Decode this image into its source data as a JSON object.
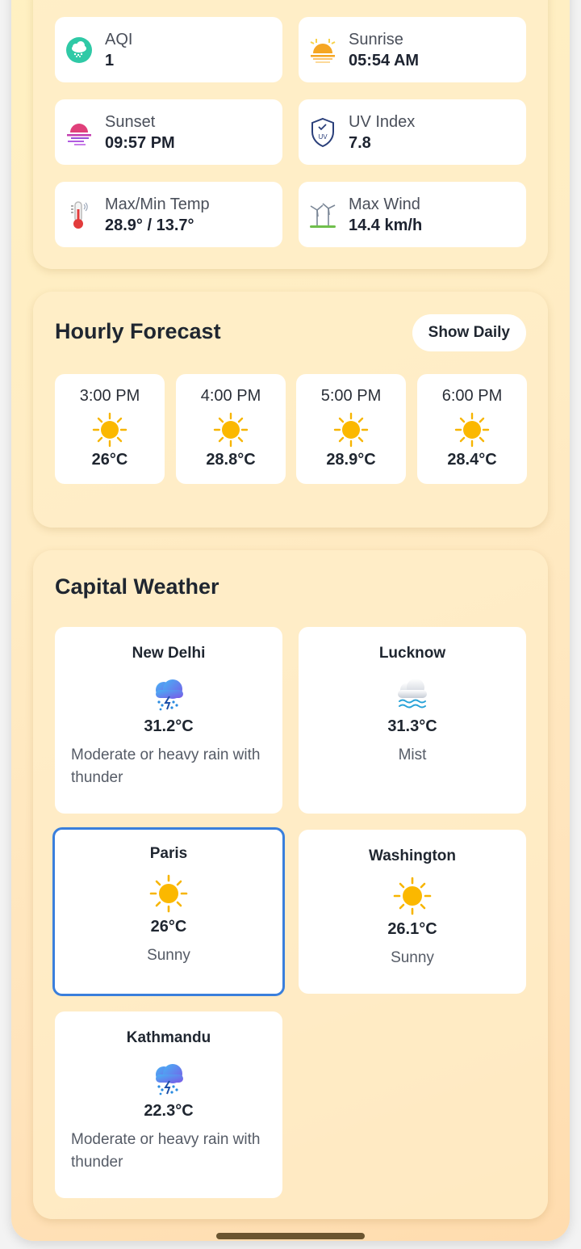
{
  "stats": [
    {
      "label": "AQI",
      "value": "1",
      "icon": "aqi-cloud-icon"
    },
    {
      "label": "Sunrise",
      "value": "05:54 AM",
      "icon": "sunrise-icon"
    },
    {
      "label": "Sunset",
      "value": "09:57 PM",
      "icon": "sunset-icon"
    },
    {
      "label": "UV Index",
      "value": "7.8",
      "icon": "uv-shield-icon"
    },
    {
      "label": "Max/Min Temp",
      "value": "28.9° / 13.7°",
      "icon": "thermometer-icon"
    },
    {
      "label": "Max Wind",
      "value": "14.4 km/h",
      "icon": "wind-turbine-icon"
    }
  ],
  "hourly": {
    "title": "Hourly Forecast",
    "toggle_label": "Show Daily",
    "items": [
      {
        "time": "3:00 PM",
        "temp": "26°C",
        "icon": "sun-icon"
      },
      {
        "time": "4:00 PM",
        "temp": "28.8°C",
        "icon": "sun-icon"
      },
      {
        "time": "5:00 PM",
        "temp": "28.9°C",
        "icon": "sun-icon"
      },
      {
        "time": "6:00 PM",
        "temp": "28.4°C",
        "icon": "sun-icon"
      }
    ]
  },
  "capitals": {
    "title": "Capital Weather",
    "items": [
      {
        "name": "New Delhi",
        "temp": "31.2°C",
        "condition": "Moderate or heavy rain with thunder",
        "icon": "thunder-rain-icon"
      },
      {
        "name": "Lucknow",
        "temp": "31.3°C",
        "condition": "Mist",
        "icon": "mist-icon"
      },
      {
        "name": "Paris",
        "temp": "26°C",
        "condition": "Sunny",
        "icon": "sun-icon",
        "selected": true
      },
      {
        "name": "Washington",
        "temp": "26.1°C",
        "condition": "Sunny",
        "icon": "sun-icon"
      },
      {
        "name": "Kathmandu",
        "temp": "22.3°C",
        "condition": "Moderate or heavy rain with thunder",
        "icon": "thunder-rain-icon"
      }
    ]
  },
  "colors": {
    "accent": "#3a7fdc",
    "sun": "#f7b500",
    "background": "#ffecc4"
  }
}
